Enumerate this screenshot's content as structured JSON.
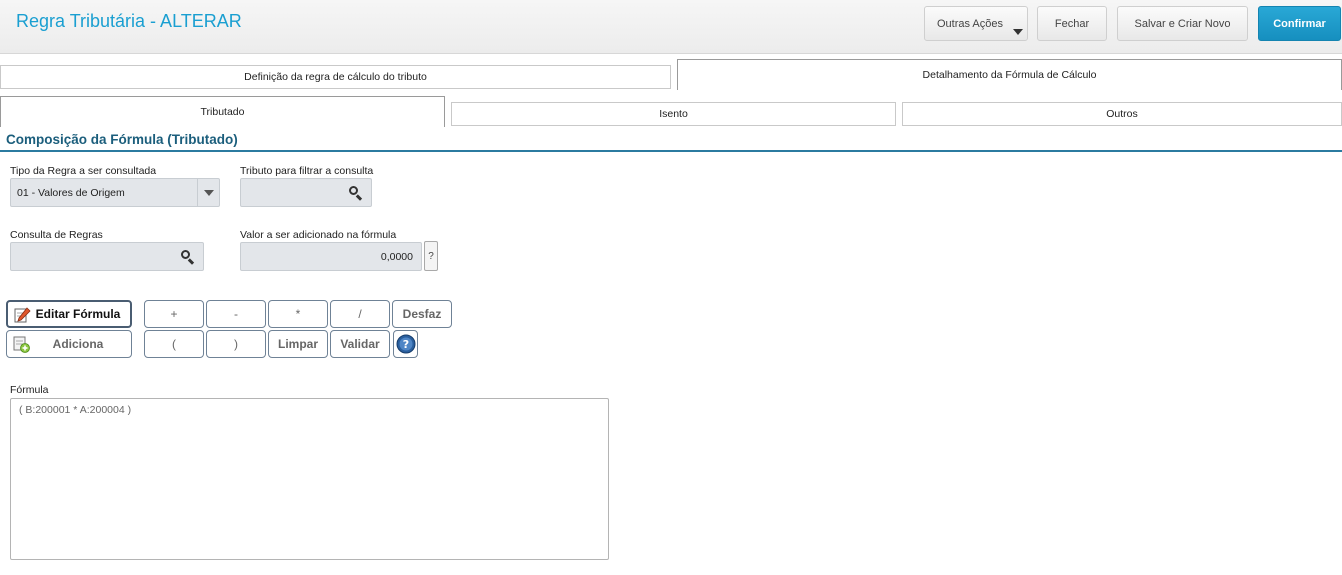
{
  "header": {
    "title": "Regra Tributária - ALTERAR",
    "buttons": {
      "other_actions": "Outras Ações",
      "close": "Fechar",
      "save_new": "Salvar e Criar Novo",
      "confirm": "Confirmar"
    }
  },
  "tabs_main": [
    {
      "label": "Definição da regra de cálculo do tributo",
      "active": false
    },
    {
      "label": "Detalhamento da Fórmula de Cálculo",
      "active": true
    }
  ],
  "tabs_sub": [
    {
      "label": "Tributado",
      "active": true
    },
    {
      "label": "Isento",
      "active": false
    },
    {
      "label": "Outros",
      "active": false
    }
  ],
  "section": {
    "title": "Composição da Fórmula (Tributado)"
  },
  "fields": {
    "rule_type": {
      "label": "Tipo da Regra a ser consultada",
      "value": "01 - Valores de Origem"
    },
    "tribute_filter": {
      "label": "Tributo para filtrar a consulta",
      "value": ""
    },
    "rules_query": {
      "label": "Consulta de Regras",
      "value": ""
    },
    "value_add": {
      "label": "Valor a ser adicionado na fórmula",
      "value": "0,0000",
      "help": "?"
    }
  },
  "formula_buttons": {
    "edit": "Editar Fórmula",
    "add": "Adiciona",
    "plus": "+",
    "minus": "-",
    "times": "*",
    "divide": "/",
    "undo": "Desfaz",
    "open_paren": "(",
    "close_paren": ")",
    "clear": "Limpar",
    "validate": "Validar"
  },
  "formula": {
    "label": "Fórmula",
    "value": "( B:200001 * A:200004 )"
  },
  "colors": {
    "title": "#1a9fd1",
    "primary": "#1a98c8",
    "section": "#1b5e7c",
    "help_icon": "#2a5f9e"
  },
  "icons": [
    "chevron-down-icon",
    "search-icon",
    "edit-pencil-icon",
    "add-document-icon",
    "help-icon"
  ]
}
